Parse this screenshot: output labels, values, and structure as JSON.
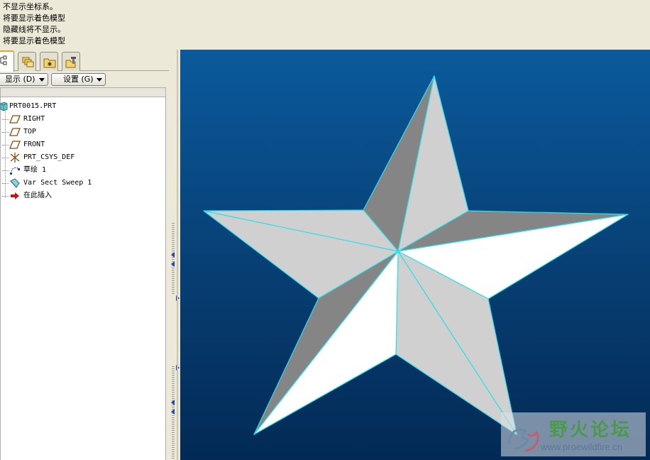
{
  "messages": [
    "不显示坐标系。",
    "将要显示着色模型",
    "隐藏线将不显示。",
    "将要显示着色模型"
  ],
  "panel": {
    "tabs": [
      "model-tree-icon",
      "layers-icon",
      "favorites-icon",
      "tools-icon"
    ],
    "show_button": "显示 (D)",
    "settings_button": "设置 (G)"
  },
  "tree": {
    "root": "PRT0015.PRT",
    "items": [
      {
        "label": "RIGHT",
        "icon": "datum-plane-icon"
      },
      {
        "label": "TOP",
        "icon": "datum-plane-icon"
      },
      {
        "label": "FRONT",
        "icon": "datum-plane-icon"
      },
      {
        "label": "PRT_CSYS_DEF",
        "icon": "coordinate-system-icon"
      },
      {
        "label": "草绘 1",
        "icon": "sketch-icon"
      },
      {
        "label": "Var Sect Sweep 1",
        "icon": "sweep-feature-icon"
      },
      {
        "label": "在此插入",
        "icon": "insert-here-arrow-icon"
      }
    ]
  },
  "graphics": {
    "model": "star-solid",
    "colors": {
      "bg_top": "#0b5a9c",
      "bg_bottom": "#032a56",
      "dark_face": "#858585",
      "light_face": "#d0d0d0",
      "white_face": "#ffffff",
      "edge": "#2ee0e8"
    }
  },
  "watermark": {
    "title": "野火论坛",
    "url": "www.proewildfire.cn"
  }
}
